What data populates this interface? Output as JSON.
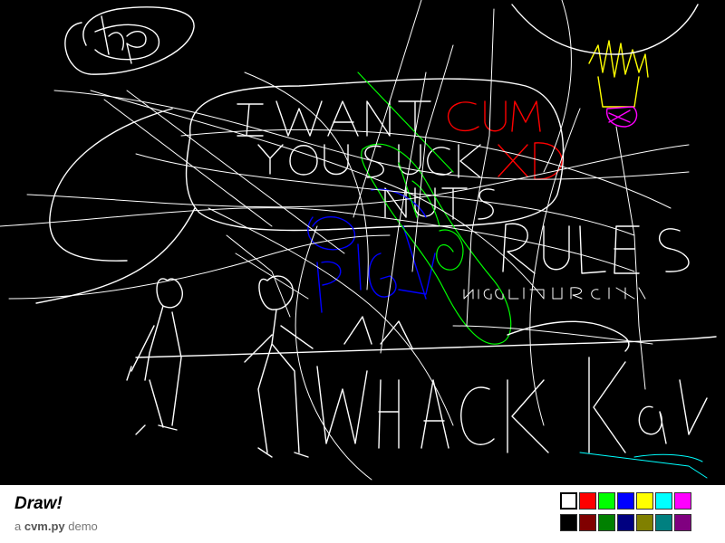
{
  "app": {
    "title": "Draw!",
    "subtitle_prefix": "a ",
    "subtitle_module": "cvm.py",
    "subtitle_suffix": " demo"
  },
  "canvas": {
    "background": "#000000",
    "drawn_text": [
      "hp",
      "I WANT",
      "CUM",
      "YOU SUCK",
      "XD",
      "NUTS",
      "RULES",
      "Nigger",
      "PIG"
    ]
  },
  "palette": {
    "selected_index": 0,
    "colors": [
      "#ffffff",
      "#ff0000",
      "#00ff00",
      "#0000ff",
      "#ffff00",
      "#00ffff",
      "#ff00ff",
      "#000000",
      "#800000",
      "#008000",
      "#000080",
      "#808000",
      "#008080",
      "#800080"
    ]
  }
}
